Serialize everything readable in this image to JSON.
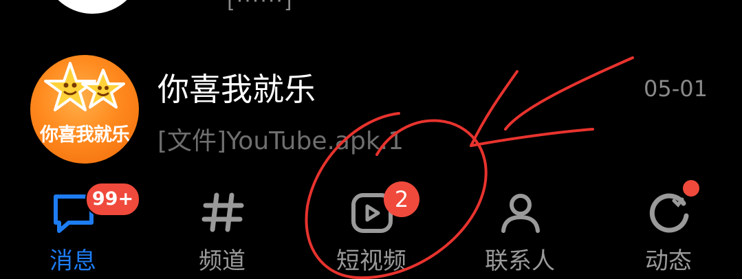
{
  "top_partial": {
    "text": "[······]"
  },
  "chat": {
    "name": "你喜我就乐",
    "avatar_text": "你喜我就乐",
    "time": "05-01",
    "preview": "[文件]YouTube.apk.1"
  },
  "tabs": [
    {
      "label": "消息",
      "icon": "message-icon",
      "badge": "99+",
      "active": true
    },
    {
      "label": "频道",
      "icon": "hashtag-icon",
      "badge": "",
      "active": false
    },
    {
      "label": "短视频",
      "icon": "short-video-icon",
      "badge": "2",
      "active": false
    },
    {
      "label": "联系人",
      "icon": "contacts-icon",
      "badge": "",
      "active": false
    },
    {
      "label": "动态",
      "icon": "activity-icon",
      "badge": "dot",
      "active": false
    }
  ],
  "colors": {
    "background": "#000000",
    "active_tab": "#1e7cf2",
    "inactive_tab": "#9a9a9a",
    "badge": "#f04a3c",
    "annotation": "#e8332e"
  }
}
